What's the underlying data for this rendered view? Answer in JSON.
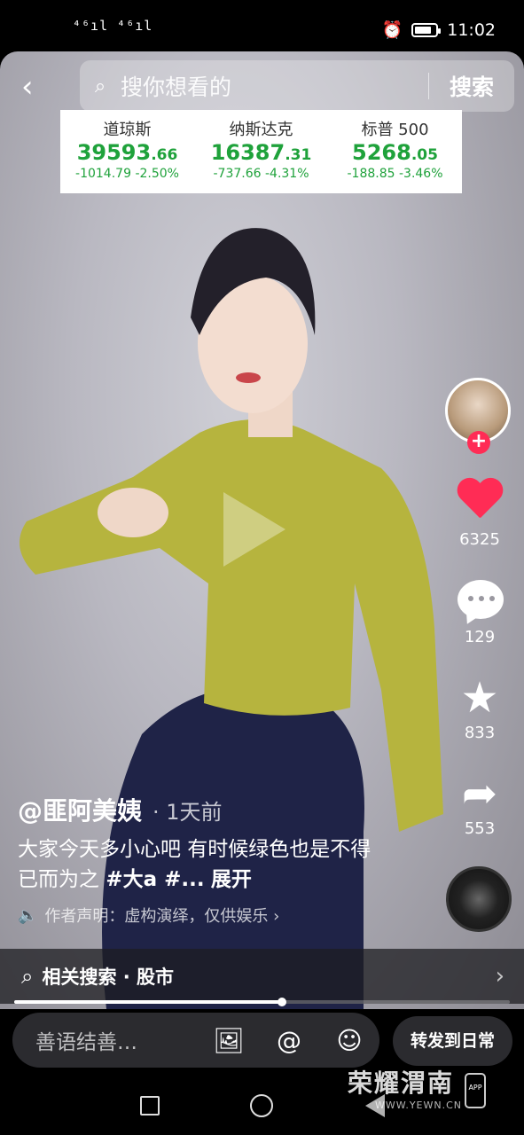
{
  "status_bar": {
    "network": "⁴⁶ıl ⁴⁶ıl",
    "time": "11:02"
  },
  "search": {
    "placeholder": "搜你想看的",
    "button": "搜索"
  },
  "ticker": [
    {
      "name": "道琼斯",
      "value_main": "39593",
      "value_dec": ".66",
      "change": "-1014.79",
      "change_pct": "-2.50%"
    },
    {
      "name": "纳斯达克",
      "value_main": "16387",
      "value_dec": ".31",
      "change": "-737.66",
      "change_pct": "-4.31%"
    },
    {
      "name": "标普 500",
      "value_main": "5268",
      "value_dec": ".05",
      "change": "-188.85",
      "change_pct": "-3.46%"
    }
  ],
  "actions": {
    "likes": "6325",
    "comments": "129",
    "favorites": "833",
    "shares": "553"
  },
  "caption": {
    "author": "@匪阿美姨",
    "time": "· 1天前",
    "desc_text": "大家今天多小心吧 有时候绿色也是不得已而为之 ",
    "desc_tags": "#大a #...",
    "expand": "展开",
    "disclaimer": "作者声明：虚构演绎，仅供娱乐 ›"
  },
  "related_search": {
    "label": "相关搜索 · 股市"
  },
  "progress": {
    "fraction": 0.54
  },
  "bottom": {
    "comment_placeholder": "善语结善…",
    "share_button": "转发到日常"
  },
  "watermark": {
    "main": "荣耀渭南",
    "sub": "WWW.YEWN.CN",
    "app": "APP"
  },
  "colors": {
    "accent_red": "#ff2c55",
    "ticker_green": "#1fa23b"
  }
}
